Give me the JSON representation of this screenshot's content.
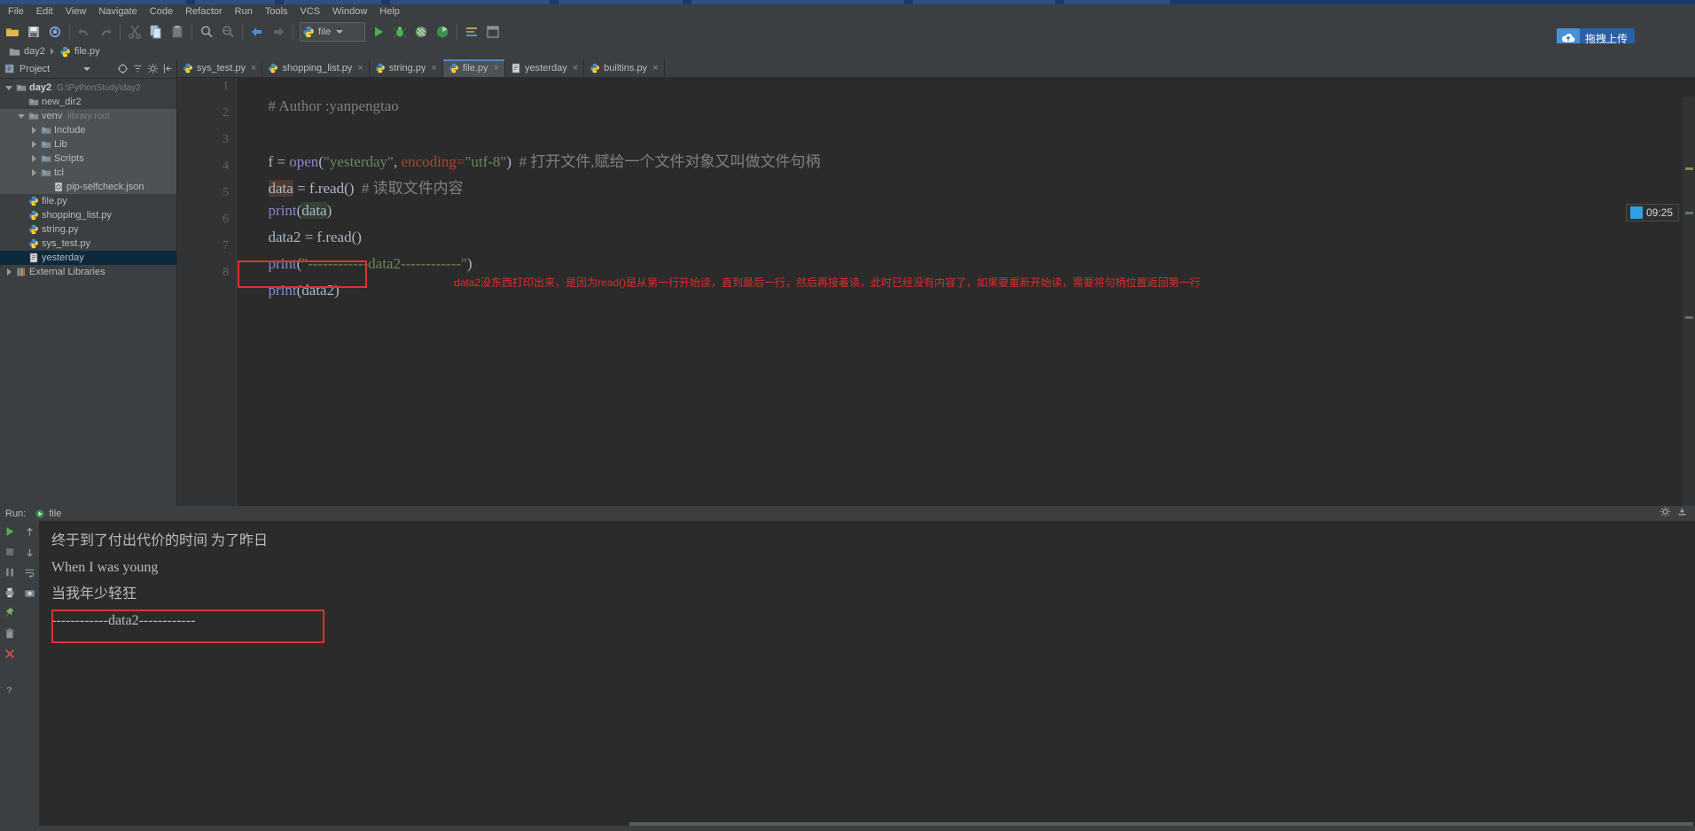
{
  "menu": {
    "items": [
      "File",
      "Edit",
      "View",
      "Navigate",
      "Code",
      "Refactor",
      "Run",
      "Tools",
      "VCS",
      "Window",
      "Help"
    ]
  },
  "toolbar": {
    "icons": [
      "open-folder-icon",
      "save-all-icon",
      "sync-icon",
      "undo-icon",
      "redo-icon",
      "cut-icon",
      "copy-icon",
      "paste-icon",
      "find-icon",
      "replace-icon",
      "back-icon",
      "forward-icon"
    ],
    "run_config": {
      "label": "file",
      "icon": "python-file-icon",
      "caret": "chevron-down-icon"
    },
    "run_button": "run-icon",
    "debug_button": "debug-icon",
    "coverage_button": "coverage-icon",
    "profile_button": "profile-icon",
    "settings_button": "settings-icon",
    "project-structure_button": "project-structure-icon"
  },
  "upload_badge": {
    "icon": "cloud-upload-icon",
    "text": "拖拽上传"
  },
  "global_search_icon": "search-icon",
  "breadcrumb": {
    "items": [
      {
        "label": "day2",
        "icon": "folder-icon"
      },
      {
        "label": "file.py",
        "icon": "python-file-icon"
      }
    ]
  },
  "project_panel": {
    "title": "Project",
    "title_icon": "project-icon",
    "caret": "chevron-down-icon",
    "actions": [
      "target-icon",
      "collapse-all-icon",
      "gear-icon",
      "hide-icon"
    ],
    "tree": [
      {
        "depth": 0,
        "twisty": "down",
        "icon": "folder-icon",
        "label": "day2",
        "sub": "G:\\PythonStudy\\day2",
        "bold": true,
        "state": "normal"
      },
      {
        "depth": 1,
        "twisty": "none",
        "icon": "folder-icon",
        "label": "new_dir2",
        "sub": "",
        "bold": false,
        "state": "normal"
      },
      {
        "depth": 1,
        "twisty": "down",
        "icon": "folder-icon",
        "label": "venv",
        "sub": "library root",
        "bold": false,
        "state": "hl"
      },
      {
        "depth": 2,
        "twisty": "right",
        "icon": "folder-icon",
        "label": "Include",
        "sub": "",
        "bold": false,
        "state": "hl"
      },
      {
        "depth": 2,
        "twisty": "right",
        "icon": "folder-icon",
        "label": "Lib",
        "sub": "",
        "bold": false,
        "state": "hl"
      },
      {
        "depth": 2,
        "twisty": "right",
        "icon": "folder-icon",
        "label": "Scripts",
        "sub": "",
        "bold": false,
        "state": "hl"
      },
      {
        "depth": 2,
        "twisty": "right",
        "icon": "folder-icon",
        "label": "tcl",
        "sub": "",
        "bold": false,
        "state": "hl"
      },
      {
        "depth": 3,
        "twisty": "none",
        "icon": "json-file-icon",
        "label": "pip-selfcheck.json",
        "sub": "",
        "bold": false,
        "state": "hl"
      },
      {
        "depth": 1,
        "twisty": "none",
        "icon": "python-file-icon",
        "label": "file.py",
        "sub": "",
        "bold": false,
        "state": "normal"
      },
      {
        "depth": 1,
        "twisty": "none",
        "icon": "python-file-icon",
        "label": "shopping_list.py",
        "sub": "",
        "bold": false,
        "state": "normal"
      },
      {
        "depth": 1,
        "twisty": "none",
        "icon": "python-file-icon",
        "label": "string.py",
        "sub": "",
        "bold": false,
        "state": "normal"
      },
      {
        "depth": 1,
        "twisty": "none",
        "icon": "python-file-icon",
        "label": "sys_test.py",
        "sub": "",
        "bold": false,
        "state": "normal"
      },
      {
        "depth": 1,
        "twisty": "none",
        "icon": "text-file-icon",
        "label": "yesterday",
        "sub": "",
        "bold": false,
        "state": "selected"
      },
      {
        "depth": 0,
        "twisty": "right",
        "icon": "libraries-icon",
        "label": "External Libraries",
        "sub": "",
        "bold": false,
        "state": "normal"
      }
    ]
  },
  "editor": {
    "tabs": [
      {
        "label": "sys_test.py",
        "icon": "python-file-icon",
        "active": false,
        "close": "×"
      },
      {
        "label": "shopping_list.py",
        "icon": "python-file-icon",
        "active": false,
        "close": "×"
      },
      {
        "label": "string.py",
        "icon": "python-file-icon",
        "active": false,
        "close": "×"
      },
      {
        "label": "file.py",
        "icon": "python-file-icon",
        "active": true,
        "close": "×"
      },
      {
        "label": "yesterday",
        "icon": "text-file-icon",
        "active": false,
        "close": "×"
      },
      {
        "label": "builtins.py",
        "icon": "python-file-icon",
        "active": false,
        "close": "×"
      }
    ],
    "line_numbers": [
      "1",
      "2",
      "3",
      "4",
      "5",
      "6",
      "7",
      "8"
    ],
    "code": {
      "l1_comment": "# Author :yanpengtao",
      "l3_f": "f",
      "l3_eq": " = ",
      "l3_open": "open",
      "l3_p1": "(",
      "l3_str1": "\"yesterday\"",
      "l3_comma": ", ",
      "l3_kwarg": "encoding",
      "l3_assign": "=",
      "l3_str2": "\"utf-8\"",
      "l3_p2": ")",
      "l3_comment": "  # 打开文件,赋给一个文件对象又叫做文件句柄",
      "l4_data": "data",
      "l4_rest": " = f.read()",
      "l4_comment": "  # 读取文件内容",
      "l5_print": "print",
      "l5_p1": "(",
      "l5_data": "data",
      "l5_p2": ")",
      "l6": "data2 = f.read()",
      "l7_print": "print",
      "l7_rest": "(",
      "l7_str": "\"------------data2------------\"",
      "l7_close": ")",
      "l8_print": "print",
      "l8_rest": "(data2)"
    },
    "annotation": "data2没东西打印出来，是因为read()是从第一行开始读，直到最后一行，然后再接着读，此时已经没有内容了，如果要重新开始读，需要将句柄位置返回第一行",
    "time_widget": {
      "text": "09:25",
      "swatch_color": "#2f9fe0"
    }
  },
  "run_window": {
    "label": "Run:",
    "tab_label": "file",
    "tab_icon": "python-run-icon",
    "header_right": [
      "gear-icon",
      "minimize-icon"
    ],
    "side_buttons": [
      "rerun-icon",
      "stop-icon",
      "pause-icon",
      "print-icon",
      "pin-icon",
      "trash-icon",
      "close-icon",
      "help-icon"
    ],
    "side_buttons2": [
      "scroll-up-icon",
      "scroll-down-icon",
      "soft-wrap-icon",
      "camera-icon"
    ],
    "console_lines": [
      "终于到了付出代价的时间 为了昨日",
      "When I was young",
      "当我年少轻狂",
      "------------data2------------"
    ],
    "highlighted_line_index": 3
  },
  "colors": {
    "accent": "#4a88c7",
    "annotation_red": "#e02b2b",
    "panel_bg": "#3c3f41",
    "editor_bg": "#2b2b2b",
    "selection_blue": "#0d293e"
  }
}
